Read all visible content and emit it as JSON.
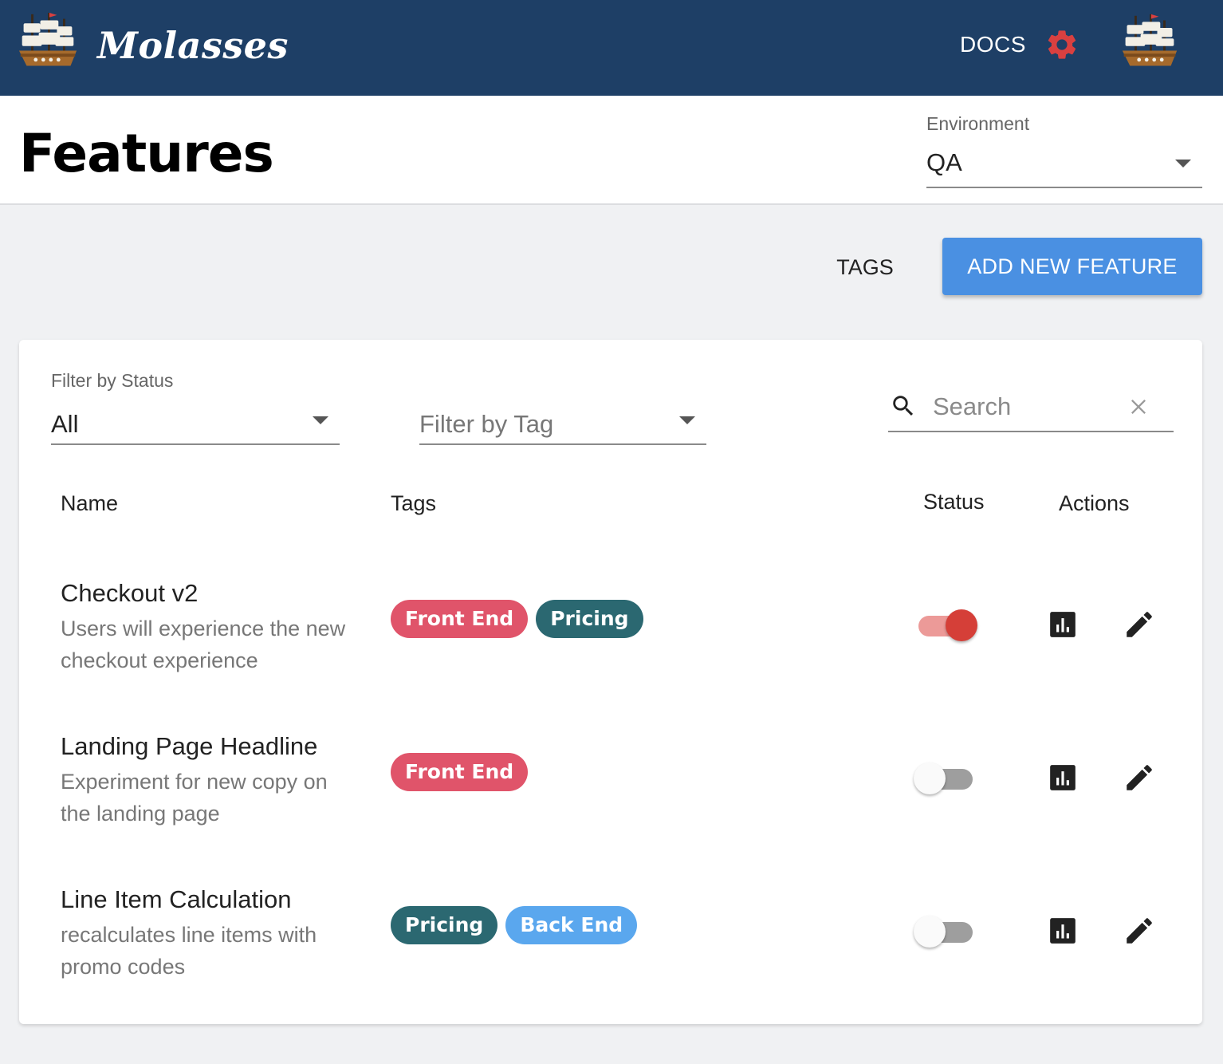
{
  "app": {
    "name": "Molasses",
    "logo_icon": "ship-icon",
    "docs_label": "DOCS",
    "settings_icon": "gear-icon",
    "avatar_icon": "ship-icon",
    "colors": {
      "navbar": "#1e3f66",
      "accent": "#4a90e2",
      "gear": "#d94040"
    }
  },
  "header": {
    "title": "Features",
    "environment": {
      "label": "Environment",
      "value": "QA"
    }
  },
  "actions": {
    "tags_label": "TAGS",
    "add_label": "ADD NEW FEATURE"
  },
  "filters": {
    "status": {
      "label": "Filter by Status",
      "value": "All"
    },
    "tag": {
      "placeholder": "Filter by Tag"
    },
    "search": {
      "placeholder": "Search"
    }
  },
  "table": {
    "columns": [
      "Name",
      "Tags",
      "Status",
      "Actions"
    ],
    "rows": [
      {
        "name": "Checkout v2",
        "description": "Users will experience the new checkout experience",
        "tags": [
          {
            "label": "Front End",
            "color": "#e0546a"
          },
          {
            "label": "Pricing",
            "color": "#2b6871"
          }
        ],
        "enabled": true
      },
      {
        "name": "Landing Page Headline",
        "description": "Experiment for new copy on the landing page",
        "tags": [
          {
            "label": "Front End",
            "color": "#e0546a"
          }
        ],
        "enabled": false
      },
      {
        "name": "Line Item Calculation",
        "description": "recalculates line items with promo codes",
        "tags": [
          {
            "label": "Pricing",
            "color": "#2b6871"
          },
          {
            "label": "Back End",
            "color": "#5aa7ee"
          }
        ],
        "enabled": false
      }
    ]
  }
}
